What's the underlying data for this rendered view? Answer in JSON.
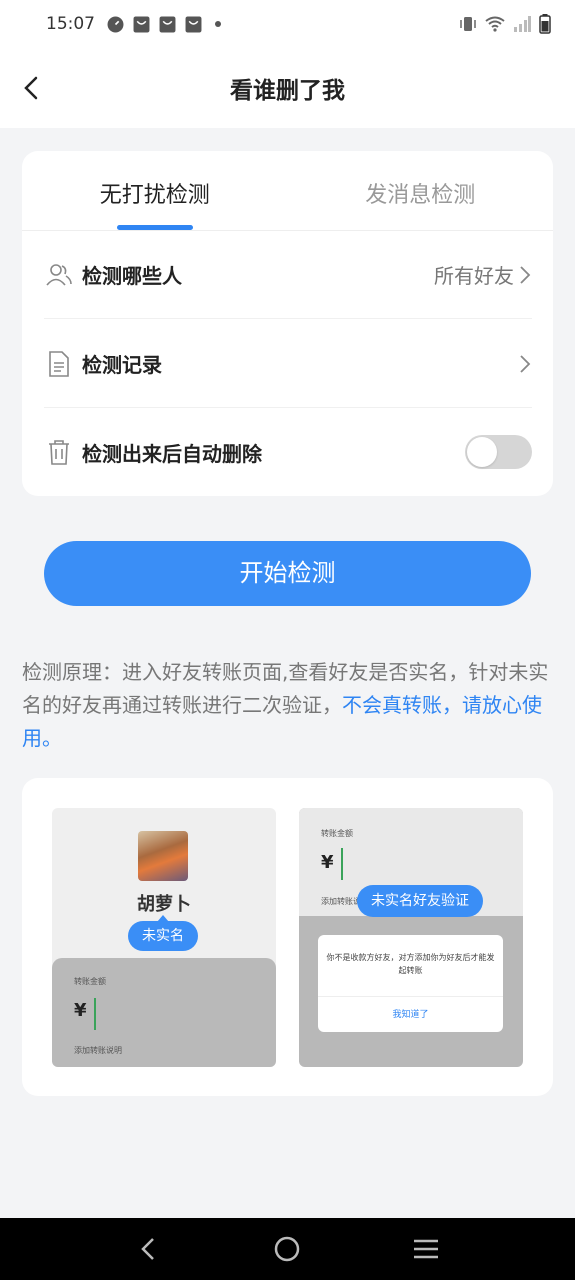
{
  "status_bar": {
    "time": "15:07"
  },
  "header": {
    "title": "看谁删了我"
  },
  "tabs": [
    {
      "label": "无打扰检测",
      "active": true
    },
    {
      "label": "发消息检测",
      "active": false
    }
  ],
  "settings": {
    "who": {
      "label": "检测哪些人",
      "value": "所有好友"
    },
    "records": {
      "label": "检测记录"
    },
    "auto_delete": {
      "label": "检测出来后自动删除",
      "enabled": false
    }
  },
  "start_button": "开始检测",
  "principle": {
    "text": "检测原理：进入好友转账页面,查看好友是否实名，针对未实名的好友再通过转账进行二次验证，",
    "highlight": "不会真转账，请放心使用。"
  },
  "illustration": {
    "left": {
      "name": "胡萝卜",
      "badge": "未实名",
      "amount_label": "转账金额",
      "currency": "¥",
      "note": "添加转账说明"
    },
    "right": {
      "amount_label": "转账金额",
      "currency": "¥",
      "note": "添加转账说",
      "badge": "未实名好友验证",
      "dialog_text": "你不是收款方好友，对方添加你为好友后才能发起转账",
      "dialog_button": "我知道了"
    }
  },
  "colors": {
    "accent": "#3a8ef6",
    "link": "#2f85f3",
    "background": "#f3f4f6"
  }
}
